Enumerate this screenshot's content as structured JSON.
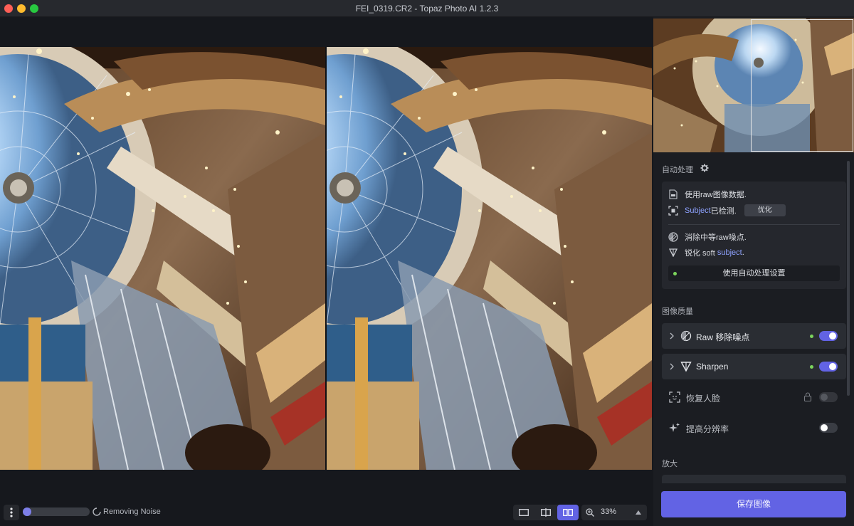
{
  "window": {
    "title": "FEI_0319.CR2 - Topaz Photo AI 1.2.3"
  },
  "bottom_bar": {
    "progress_fraction": 0.12,
    "status_text": "Removing Noise",
    "zoom_value": "33%",
    "view_modes": [
      "single-view-icon",
      "split-view-icon",
      "side-by-side-icon"
    ],
    "active_view": "side-by-side-icon"
  },
  "sidebar": {
    "auto_section_label": "自动处理",
    "auto": {
      "raw_text": "使用raw图像数据.",
      "subject_word": "Subject",
      "subject_detected": " 已检测.",
      "optimize_button": "优化",
      "noise_text": "消除中等raw噪点.",
      "sharpen_prefix": "锐化 soft ",
      "sharpen_subject": "subject",
      "sharpen_suffix": ".",
      "settings_button": "使用自动处理设置"
    },
    "quality_section_label": "图像质量",
    "quality_items": [
      {
        "label": "Raw 移除噪点",
        "enabled": true,
        "expandable": true
      },
      {
        "label": "Sharpen",
        "enabled": true,
        "expandable": true
      },
      {
        "label": "恢复人脸",
        "enabled": false,
        "locked": true
      },
      {
        "label": "提高分辨率",
        "enabled": false
      }
    ],
    "upscale_section_label": "放大",
    "save_button": "保存图像"
  },
  "colors": {
    "accent": "#6263e4",
    "link": "#8ea2ff",
    "status_dot": "#7cd45c",
    "panel": "#1b1d22",
    "card": "#25272d"
  }
}
